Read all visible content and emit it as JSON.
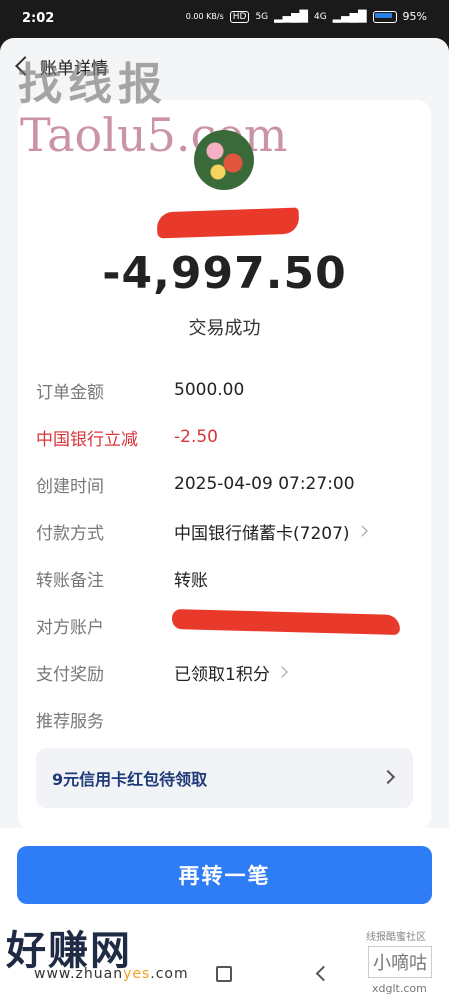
{
  "status_bar": {
    "time": "2:02",
    "net_speed": "0.00 KB/s",
    "hd": "HD",
    "sig1": "5G",
    "sig2": "4G",
    "battery": "95%"
  },
  "header": {
    "title": "账单详情"
  },
  "transaction": {
    "amount": "-4,997.50",
    "status": "交易成功"
  },
  "details": [
    {
      "label": "订单金额",
      "value": "5000.00"
    },
    {
      "label": "中国银行立减",
      "value": "-2.50"
    },
    {
      "label": "创建时间",
      "value": "2025-04-09  07:27:00"
    },
    {
      "label": "付款方式",
      "value": "中国银行储蓄卡(7207)"
    },
    {
      "label": "转账备注",
      "value": "转账"
    },
    {
      "label": "对方账户",
      "value": ""
    },
    {
      "label": "支付奖励",
      "value": "已领取1积分"
    },
    {
      "label": "推荐服务",
      "value": ""
    }
  ],
  "promo": {
    "text": "9元信用卡红包待领取"
  },
  "primary_action": {
    "label": "再转一笔"
  },
  "colors": {
    "primary": "#2f7df6",
    "discount_red": "#d9353b",
    "redaction": "#e8392b"
  },
  "watermarks": {
    "wm1": "找线报",
    "wm2": "Taolu5.com",
    "wm3": "好赚网",
    "wm4_pre": "www.zhuan",
    "wm4_hl": "yes",
    "wm4_post": ".com",
    "wm5": "线报酷蜜社区",
    "wm6": "小嘀咕",
    "wm7": "xdglt.com"
  }
}
